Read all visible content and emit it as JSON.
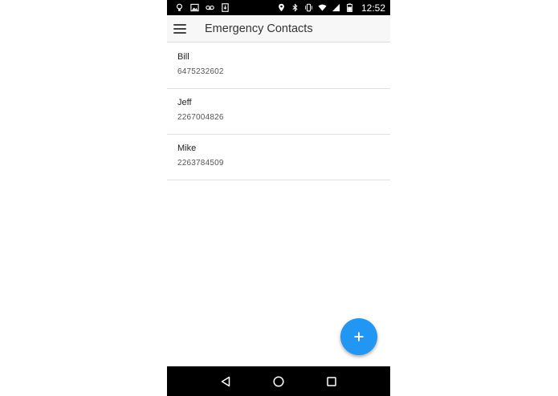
{
  "status_bar": {
    "left_icons": [
      "bulb-icon",
      "image-icon",
      "voicemail-icon",
      "download-icon"
    ],
    "right_icons": [
      "location-icon",
      "bluetooth-icon",
      "vibrate-icon",
      "wifi-icon",
      "signal-icon",
      "battery-icon"
    ],
    "time": "12:52"
  },
  "app_bar": {
    "menu_icon": "menu-icon",
    "title": "Emergency Contacts"
  },
  "contacts": [
    {
      "name": "Bill",
      "phone": "6475232602"
    },
    {
      "name": "Jeff",
      "phone": "2267004826"
    },
    {
      "name": "Mike",
      "phone": "2263784509"
    }
  ],
  "fab": {
    "icon": "plus-icon"
  },
  "nav_bar": {
    "icons": [
      "back-icon",
      "home-icon",
      "recents-icon"
    ]
  },
  "colors": {
    "accent": "#2196f3",
    "app_bar": "#f7f7f7",
    "system_bar": "#000000"
  }
}
